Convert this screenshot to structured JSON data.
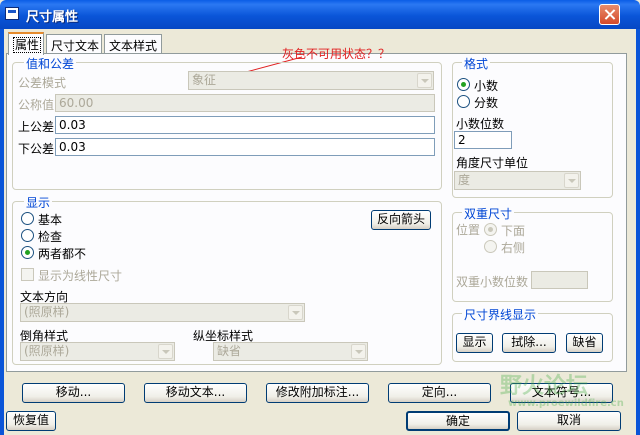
{
  "window": {
    "title": "尺寸属性"
  },
  "tabs": [
    {
      "label": "属性",
      "active": true
    },
    {
      "label": "尺寸文本",
      "active": false
    },
    {
      "label": "文本样式",
      "active": false
    }
  ],
  "annotation": "灰色不可用状态？？",
  "value_tolerance": {
    "title": "值和公差",
    "tolerance_mode_label": "公差模式",
    "tolerance_mode_value": "象征",
    "nominal_label": "公称值",
    "nominal_value": "60.00",
    "upper_label": "上公差",
    "upper_value": "0.03",
    "lower_label": "下公差",
    "lower_value": "0.03"
  },
  "format": {
    "title": "格式",
    "decimal_label": "小数",
    "fraction_label": "分数",
    "selected": "decimal",
    "decimal_places_label": "小数位数",
    "decimal_places_value": "2",
    "angle_unit_label": "角度尺寸单位",
    "angle_unit_value": "度"
  },
  "display": {
    "title": "显示",
    "options": [
      "基本",
      "检查",
      "两者都不"
    ],
    "selected_index": 2,
    "flip_arrows_label": "反向箭头",
    "linear_label": "显示为线性尺寸",
    "text_direction_label": "文本方向",
    "text_direction_value": "(照原样)",
    "chamfer_label": "倒角样式",
    "chamfer_value": "(照原样)",
    "ordinate_label": "纵坐标样式",
    "ordinate_value": "缺省"
  },
  "dual": {
    "title": "双重尺寸",
    "position_label": "位置",
    "below_label": "下面",
    "right_label": "右侧",
    "dual_decimal_label": "双重小数位数"
  },
  "witness": {
    "title": "尺寸界线显示",
    "show_label": "显示",
    "erase_label": "拭除...",
    "default_label": "缺省"
  },
  "actions": {
    "move": "移动...",
    "move_text": "移动文本...",
    "edit_attach": "修改附加标注...",
    "orient": "定向...",
    "text_symbol": "文本符号..."
  },
  "footer": {
    "restore": "恢复值",
    "ok": "确定",
    "cancel": "取消"
  },
  "watermark": {
    "line1": "野火论坛",
    "line2": "www.proewildfire.cn"
  }
}
